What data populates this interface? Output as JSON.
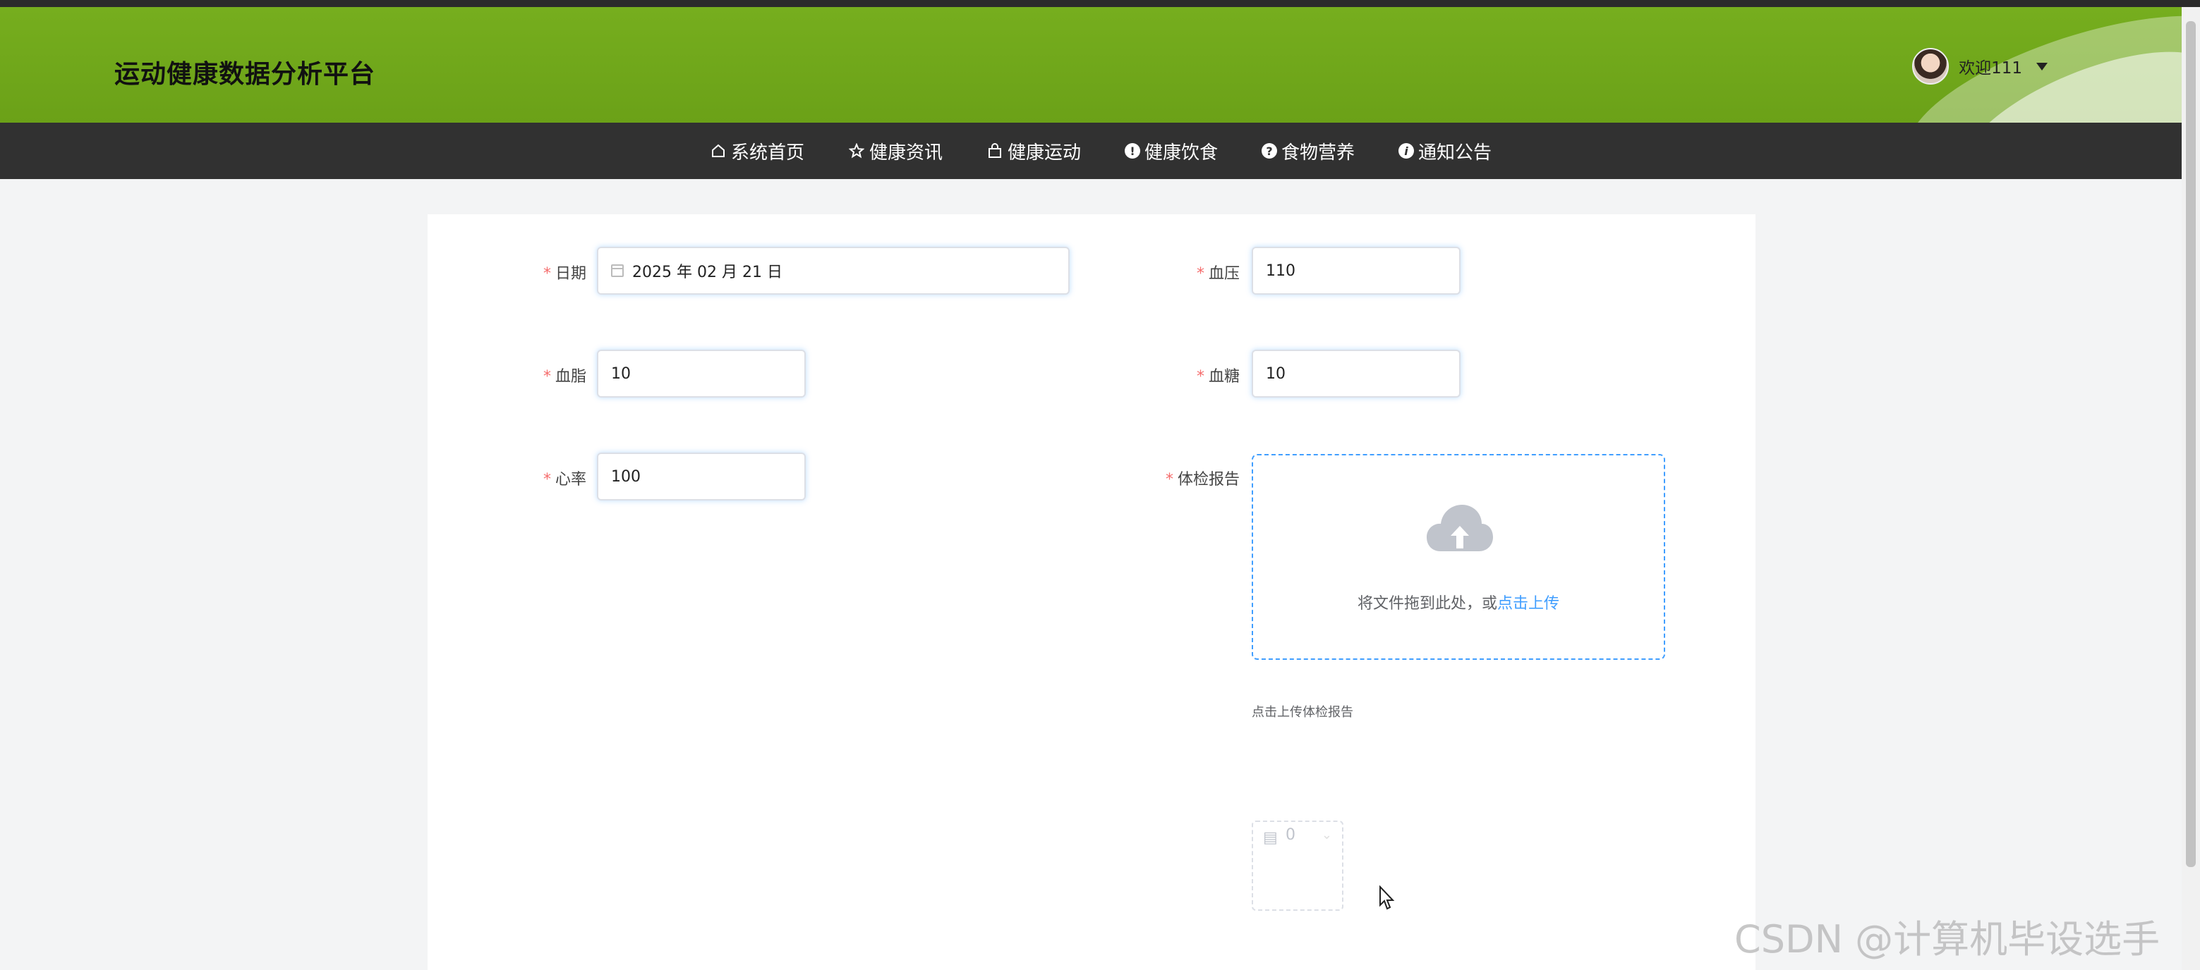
{
  "header": {
    "brand": "运动健康数据分析平台",
    "user_label": "欢迎111"
  },
  "nav": {
    "items": [
      {
        "label": "系统首页",
        "icon": "home-icon"
      },
      {
        "label": "健康资讯",
        "icon": "star-icon"
      },
      {
        "label": "健康运动",
        "icon": "bag-icon"
      },
      {
        "label": "健康饮食",
        "icon": "exclamation-icon"
      },
      {
        "label": "食物营养",
        "icon": "question-icon"
      },
      {
        "label": "通知公告",
        "icon": "info-icon"
      }
    ]
  },
  "form": {
    "date": {
      "label": "日期",
      "value": "2025 年 02 月 21 日"
    },
    "blood_pressure": {
      "label": "血压",
      "value": "110"
    },
    "blood_lipid": {
      "label": "血脂",
      "value": "10"
    },
    "blood_sugar": {
      "label": "血糖",
      "value": "10"
    },
    "heart_rate": {
      "label": "心率",
      "value": "100"
    },
    "report": {
      "label": "体检报告",
      "drag_text": "将文件拖到此处，或",
      "click_text": "点击上传",
      "tip": "点击上传体检报告"
    },
    "mini_value": "0"
  },
  "watermark": "CSDN @计算机毕设选手",
  "colors": {
    "header_green": "#76ae1e",
    "nav_bg": "#313131",
    "link_blue": "#409eff",
    "required_red": "#f56c6c"
  }
}
